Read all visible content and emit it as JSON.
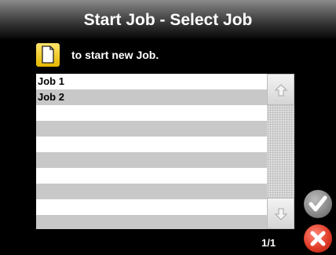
{
  "header": {
    "title": "Start Job - Select Job"
  },
  "new_job": {
    "hint": "to start new Job."
  },
  "job_list": {
    "rows": [
      "Job 1",
      "Job 2",
      "",
      "",
      "",
      "",
      "",
      "",
      "",
      ""
    ]
  },
  "pagination": {
    "indicator": "1/1"
  },
  "icons": {
    "new_job": "document-icon",
    "scroll_up": "arrow-up-icon",
    "scroll_down": "arrow-down-icon",
    "accept": "checkmark-icon",
    "cancel": "x-icon"
  },
  "colors": {
    "row_alt": "#c8c8c8",
    "new_job_button": "#f5c800",
    "accept_button": "#8a8a8a",
    "cancel_button": "#e03c28"
  }
}
